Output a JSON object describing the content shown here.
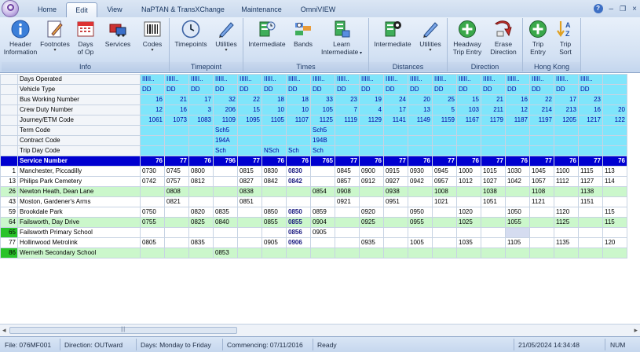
{
  "tabs": [
    "Home",
    "Edit",
    "View",
    "NaPTAN & TransXChange",
    "Maintenance",
    "OmniVIEW"
  ],
  "active_tab": "Edit",
  "window_controls": [
    "?",
    "–",
    "×"
  ],
  "ribbon": {
    "info": {
      "label": "Info",
      "buttons": [
        {
          "line1": "Header",
          "line2": "Information"
        },
        {
          "line1": "Footnotes",
          "line2": ""
        },
        {
          "line1": "Days",
          "line2": "of Op"
        },
        {
          "line1": "Services",
          "line2": ""
        },
        {
          "line1": "Codes",
          "line2": ""
        }
      ]
    },
    "timepoint": {
      "label": "Timepoint",
      "buttons": [
        {
          "line1": "Timepoints",
          "line2": ""
        },
        {
          "line1": "Utilities",
          "line2": ""
        }
      ]
    },
    "times": {
      "label": "Times",
      "buttons": [
        {
          "line1": "Intermediate",
          "line2": ""
        },
        {
          "line1": "Bands",
          "line2": ""
        },
        {
          "line1": "Learn",
          "line2": "Intermediate"
        }
      ]
    },
    "distances": {
      "label": "Distances",
      "buttons": [
        {
          "line1": "Intermediate",
          "line2": ""
        },
        {
          "line1": "Utilities",
          "line2": ""
        }
      ]
    },
    "direction": {
      "label": "Direction",
      "buttons": [
        {
          "line1": "Headway",
          "line2": "Trip Entry"
        },
        {
          "line1": "Erase",
          "line2": "Direction"
        }
      ]
    },
    "hongkong": {
      "label": "Hong Kong",
      "buttons": [
        {
          "line1": "Trip",
          "line2": "Entry"
        },
        {
          "line1": "Trip",
          "line2": "Sort"
        }
      ]
    }
  },
  "grid": {
    "header_rows": [
      {
        "label": "Days Operated",
        "values": [
          "IIIII..",
          "IIIII..",
          "IIIII..",
          "IIIII..",
          "IIIII..",
          "IIIII..",
          "IIIII..",
          "IIIII..",
          "IIIII..",
          "IIIII..",
          "IIIII..",
          "IIIII..",
          "IIIII..",
          "IIIII..",
          "IIIII..",
          "IIIII..",
          "IIIII..",
          "IIIII..",
          "IIIII.."
        ]
      },
      {
        "label": "Vehicle Type",
        "values": [
          "DD",
          "DD",
          "DD",
          "DD",
          "DD",
          "DD",
          "DD",
          "DD",
          "DD",
          "DD",
          "DD",
          "DD",
          "DD",
          "DD",
          "DD",
          "DD",
          "DD",
          "DD",
          "DD"
        ]
      },
      {
        "label": "Bus Working Number",
        "values": [
          "16",
          "21",
          "17",
          "32",
          "22",
          "18",
          "18",
          "33",
          "23",
          "19",
          "24",
          "20",
          "25",
          "15",
          "21",
          "16",
          "22",
          "17",
          "23"
        ]
      },
      {
        "label": "Crew Duty Number",
        "values": [
          "12",
          "16",
          "3",
          "206",
          "15",
          "10",
          "10",
          "105",
          "7",
          "4",
          "17",
          "13",
          "5",
          "103",
          "211",
          "12",
          "214",
          "213",
          "16",
          "20"
        ]
      },
      {
        "label": "Journey/ETM Code",
        "values": [
          "1061",
          "1073",
          "1083",
          "1109",
          "1095",
          "1105",
          "1107",
          "1125",
          "1119",
          "1129",
          "1141",
          "1149",
          "1159",
          "1167",
          "1179",
          "1187",
          "1197",
          "1205",
          "1217",
          "122"
        ]
      },
      {
        "label": "Term Code",
        "values": [
          "",
          "",
          "",
          "Sch5",
          "",
          "",
          "",
          "Sch5",
          "",
          "",
          "",
          "",
          "",
          "",
          "",
          "",
          "",
          "",
          "",
          ""
        ]
      },
      {
        "label": "Contract Code",
        "values": [
          "",
          "",
          "",
          "194A",
          "",
          "",
          "",
          "194B",
          "",
          "",
          "",
          "",
          "",
          "",
          "",
          "",
          "",
          "",
          "",
          ""
        ]
      },
      {
        "label": "Trip Day Code",
        "values": [
          "",
          "",
          "",
          "Sch",
          "",
          "NSch",
          "Sch",
          "Sch",
          "",
          "",
          "",
          "",
          "",
          "",
          "",
          "",
          "",
          "",
          "",
          ""
        ]
      }
    ],
    "service_row": {
      "label": "Service Number",
      "values": [
        "76",
        "77",
        "76",
        "796",
        "77",
        "76",
        "76",
        "765",
        "77",
        "76",
        "77",
        "76",
        "77",
        "76",
        "77",
        "76",
        "77",
        "76",
        "77",
        "76"
      ]
    },
    "stops": [
      {
        "num": "1",
        "name": "Manchester, Piccadilly",
        "green": false,
        "times": [
          "0730",
          "0745",
          "0800",
          "",
          "0815",
          "0830",
          "0830",
          "",
          "0845",
          "0900",
          "0915",
          "0930",
          "0945",
          "1000",
          "1015",
          "1030",
          "1045",
          "1100",
          "1115",
          "113"
        ]
      },
      {
        "num": "13",
        "name": "Philips Park Cemetery",
        "green": false,
        "times": [
          "0742",
          "0757",
          "0812",
          "",
          "0827",
          "0842",
          "0842",
          "",
          "0857",
          "0912",
          "0927",
          "0942",
          "0957",
          "1012",
          "1027",
          "1042",
          "1057",
          "1112",
          "1127",
          "114"
        ]
      },
      {
        "num": "26",
        "name": "Newton Heath, Dean Lane",
        "green": true,
        "times": [
          "",
          "0808",
          "",
          "",
          "0838",
          "",
          "",
          "0854",
          "0908",
          "",
          "0938",
          "",
          "1008",
          "",
          "1038",
          "",
          "1108",
          "",
          "1138",
          ""
        ]
      },
      {
        "num": "43",
        "name": "Moston, Gardener's Arms",
        "green": false,
        "times": [
          "",
          "0821",
          "",
          "",
          "0851",
          "",
          "",
          "",
          "0921",
          "",
          "0951",
          "",
          "1021",
          "",
          "1051",
          "",
          "1121",
          "",
          "1151",
          ""
        ]
      },
      {
        "num": "59",
        "name": "Brookdale Park",
        "green": false,
        "times": [
          "0750",
          "",
          "0820",
          "0835",
          "",
          "0850",
          "0850",
          "0859",
          "",
          "0920",
          "",
          "0950",
          "",
          "1020",
          "",
          "1050",
          "",
          "1120",
          "",
          "115"
        ]
      },
      {
        "num": "64",
        "name": "Failsworth, Day Drive",
        "green": true,
        "times": [
          "0755",
          "",
          "0825",
          "0840",
          "",
          "0855",
          "0855",
          "0904",
          "",
          "0925",
          "",
          "0955",
          "",
          "1025",
          "",
          "1055",
          "",
          "1125",
          "",
          "115"
        ]
      },
      {
        "num": "65",
        "name": "Failsworth Primary School",
        "green": false,
        "numgreen": true,
        "times": [
          "",
          "",
          "",
          "",
          "",
          "",
          "0856",
          "0905",
          "",
          "",
          "",
          "",
          "",
          "",
          "",
          "",
          "",
          "",
          "",
          ""
        ]
      },
      {
        "num": "77",
        "name": "Hollinwood Metrolink",
        "green": false,
        "times": [
          "0805",
          "",
          "0835",
          "",
          "",
          "0905",
          "0906",
          "",
          "",
          "0935",
          "",
          "1005",
          "",
          "1035",
          "",
          "1105",
          "",
          "1135",
          "",
          "120"
        ]
      },
      {
        "num": "86",
        "name": "Werneth Secondary School",
        "green": true,
        "numgreen": true,
        "times": [
          "",
          "",
          "",
          "0853",
          "",
          "",
          "",
          "",
          "",
          "",
          "",
          "",
          "",
          "",
          "",
          "",
          "",
          "",
          "",
          ""
        ]
      }
    ]
  },
  "scrollbar": {
    "left": "◂",
    "right": "▸",
    "grip": "|||"
  },
  "status": {
    "file": "File: 076MF001",
    "direction": "Direction: OUTward",
    "days": "Days: Monday to Friday",
    "commencing": "Commencing: 07/11/2016",
    "state": "Ready",
    "datetime": "21/05/2024 14:34:48",
    "num": "NUM"
  }
}
